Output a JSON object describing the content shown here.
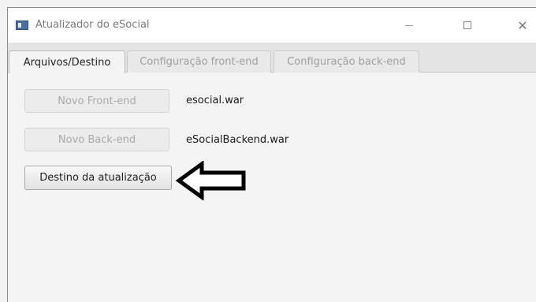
{
  "window": {
    "title": "Atualizador do eSocial",
    "controls": {
      "minimize_icon": "minimize-icon",
      "maximize_icon": "maximize-icon",
      "close_icon": "close-icon",
      "close_glyph": "✕"
    }
  },
  "tabs": [
    {
      "label": "Arquivos/Destino",
      "active": true
    },
    {
      "label": "Configuração front-end",
      "active": false
    },
    {
      "label": "Configuração back-end",
      "active": false
    }
  ],
  "main": {
    "front_button": "Novo Front-end",
    "front_file": "esocial.war",
    "back_button": "Novo Back-end",
    "back_file": "eSocialBackend.war",
    "dest_button": "Destino da atualização"
  },
  "annotation": {
    "arrow_icon": "left-arrow-icon",
    "arrow_color": "#000000"
  }
}
